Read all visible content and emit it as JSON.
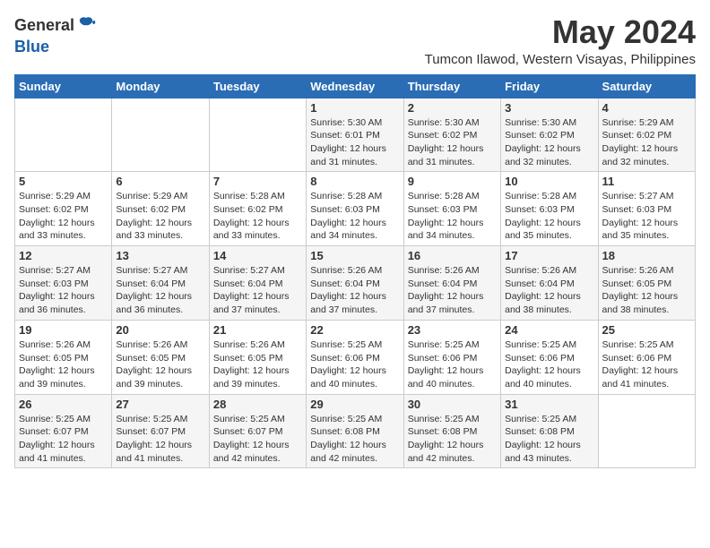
{
  "logo": {
    "general": "General",
    "blue": "Blue"
  },
  "title": "May 2024",
  "location": "Tumcon Ilawod, Western Visayas, Philippines",
  "weekdays": [
    "Sunday",
    "Monday",
    "Tuesday",
    "Wednesday",
    "Thursday",
    "Friday",
    "Saturday"
  ],
  "weeks": [
    [
      {
        "day": "",
        "info": ""
      },
      {
        "day": "",
        "info": ""
      },
      {
        "day": "",
        "info": ""
      },
      {
        "day": "1",
        "info": "Sunrise: 5:30 AM\nSunset: 6:01 PM\nDaylight: 12 hours\nand 31 minutes."
      },
      {
        "day": "2",
        "info": "Sunrise: 5:30 AM\nSunset: 6:02 PM\nDaylight: 12 hours\nand 31 minutes."
      },
      {
        "day": "3",
        "info": "Sunrise: 5:30 AM\nSunset: 6:02 PM\nDaylight: 12 hours\nand 32 minutes."
      },
      {
        "day": "4",
        "info": "Sunrise: 5:29 AM\nSunset: 6:02 PM\nDaylight: 12 hours\nand 32 minutes."
      }
    ],
    [
      {
        "day": "5",
        "info": "Sunrise: 5:29 AM\nSunset: 6:02 PM\nDaylight: 12 hours\nand 33 minutes."
      },
      {
        "day": "6",
        "info": "Sunrise: 5:29 AM\nSunset: 6:02 PM\nDaylight: 12 hours\nand 33 minutes."
      },
      {
        "day": "7",
        "info": "Sunrise: 5:28 AM\nSunset: 6:02 PM\nDaylight: 12 hours\nand 33 minutes."
      },
      {
        "day": "8",
        "info": "Sunrise: 5:28 AM\nSunset: 6:03 PM\nDaylight: 12 hours\nand 34 minutes."
      },
      {
        "day": "9",
        "info": "Sunrise: 5:28 AM\nSunset: 6:03 PM\nDaylight: 12 hours\nand 34 minutes."
      },
      {
        "day": "10",
        "info": "Sunrise: 5:28 AM\nSunset: 6:03 PM\nDaylight: 12 hours\nand 35 minutes."
      },
      {
        "day": "11",
        "info": "Sunrise: 5:27 AM\nSunset: 6:03 PM\nDaylight: 12 hours\nand 35 minutes."
      }
    ],
    [
      {
        "day": "12",
        "info": "Sunrise: 5:27 AM\nSunset: 6:03 PM\nDaylight: 12 hours\nand 36 minutes."
      },
      {
        "day": "13",
        "info": "Sunrise: 5:27 AM\nSunset: 6:04 PM\nDaylight: 12 hours\nand 36 minutes."
      },
      {
        "day": "14",
        "info": "Sunrise: 5:27 AM\nSunset: 6:04 PM\nDaylight: 12 hours\nand 37 minutes."
      },
      {
        "day": "15",
        "info": "Sunrise: 5:26 AM\nSunset: 6:04 PM\nDaylight: 12 hours\nand 37 minutes."
      },
      {
        "day": "16",
        "info": "Sunrise: 5:26 AM\nSunset: 6:04 PM\nDaylight: 12 hours\nand 37 minutes."
      },
      {
        "day": "17",
        "info": "Sunrise: 5:26 AM\nSunset: 6:04 PM\nDaylight: 12 hours\nand 38 minutes."
      },
      {
        "day": "18",
        "info": "Sunrise: 5:26 AM\nSunset: 6:05 PM\nDaylight: 12 hours\nand 38 minutes."
      }
    ],
    [
      {
        "day": "19",
        "info": "Sunrise: 5:26 AM\nSunset: 6:05 PM\nDaylight: 12 hours\nand 39 minutes."
      },
      {
        "day": "20",
        "info": "Sunrise: 5:26 AM\nSunset: 6:05 PM\nDaylight: 12 hours\nand 39 minutes."
      },
      {
        "day": "21",
        "info": "Sunrise: 5:26 AM\nSunset: 6:05 PM\nDaylight: 12 hours\nand 39 minutes."
      },
      {
        "day": "22",
        "info": "Sunrise: 5:25 AM\nSunset: 6:06 PM\nDaylight: 12 hours\nand 40 minutes."
      },
      {
        "day": "23",
        "info": "Sunrise: 5:25 AM\nSunset: 6:06 PM\nDaylight: 12 hours\nand 40 minutes."
      },
      {
        "day": "24",
        "info": "Sunrise: 5:25 AM\nSunset: 6:06 PM\nDaylight: 12 hours\nand 40 minutes."
      },
      {
        "day": "25",
        "info": "Sunrise: 5:25 AM\nSunset: 6:06 PM\nDaylight: 12 hours\nand 41 minutes."
      }
    ],
    [
      {
        "day": "26",
        "info": "Sunrise: 5:25 AM\nSunset: 6:07 PM\nDaylight: 12 hours\nand 41 minutes."
      },
      {
        "day": "27",
        "info": "Sunrise: 5:25 AM\nSunset: 6:07 PM\nDaylight: 12 hours\nand 41 minutes."
      },
      {
        "day": "28",
        "info": "Sunrise: 5:25 AM\nSunset: 6:07 PM\nDaylight: 12 hours\nand 42 minutes."
      },
      {
        "day": "29",
        "info": "Sunrise: 5:25 AM\nSunset: 6:08 PM\nDaylight: 12 hours\nand 42 minutes."
      },
      {
        "day": "30",
        "info": "Sunrise: 5:25 AM\nSunset: 6:08 PM\nDaylight: 12 hours\nand 42 minutes."
      },
      {
        "day": "31",
        "info": "Sunrise: 5:25 AM\nSunset: 6:08 PM\nDaylight: 12 hours\nand 43 minutes."
      },
      {
        "day": "",
        "info": ""
      }
    ]
  ]
}
